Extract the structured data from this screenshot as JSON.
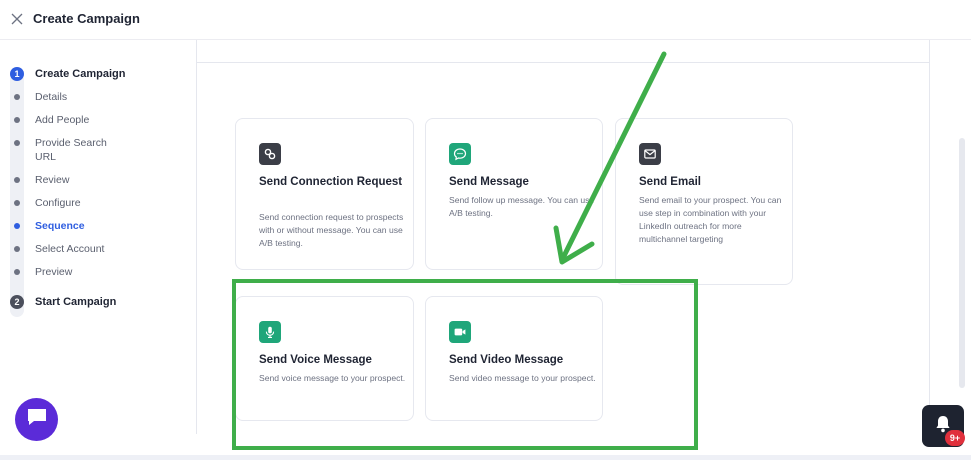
{
  "header": {
    "title": "Create Campaign"
  },
  "sidebar": {
    "step1": {
      "number": "1",
      "title": "Create Campaign"
    },
    "substeps": [
      {
        "label": "Details"
      },
      {
        "label": "Add People"
      },
      {
        "label": "Provide Search URL"
      },
      {
        "label": "Review"
      },
      {
        "label": "Configure"
      },
      {
        "label": "Sequence"
      },
      {
        "label": "Select Account"
      },
      {
        "label": "Preview"
      }
    ],
    "active_substep": "Sequence",
    "step2": {
      "number": "2",
      "title": "Start Campaign"
    }
  },
  "cards": [
    {
      "icon": "link-icon",
      "title": "Send Connection Request",
      "desc": "Send connection request to prospects with or without message. You can use A/B testing."
    },
    {
      "icon": "message-icon",
      "title": "Send Message",
      "desc": "Send follow up message. You can use A/B testing."
    },
    {
      "icon": "email-icon",
      "title": "Send Email",
      "desc": "Send email to your prospect. You can use step in combination with your LinkedIn outreach for more multichannel targeting"
    },
    {
      "icon": "microphone-icon",
      "title": "Send Voice Message",
      "desc": "Send voice message to your prospect."
    },
    {
      "icon": "video-icon",
      "title": "Send Video Message",
      "desc": "Send video message to your prospect."
    }
  ],
  "notifications": {
    "badge": "9+"
  },
  "colors": {
    "accent": "#2f5ee0",
    "icon_green": "#1fa67a",
    "icon_dark": "#3b3e47",
    "highlight": "#3fae4a",
    "chat": "#5b2bd8",
    "badge": "#e0303c"
  }
}
